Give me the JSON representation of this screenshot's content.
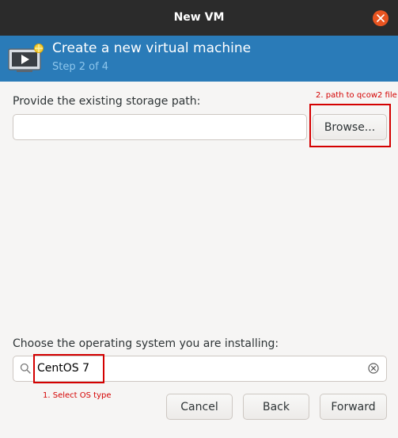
{
  "window": {
    "title": "New VM"
  },
  "header": {
    "title": "Create a new virtual machine",
    "step": "Step 2 of 4"
  },
  "storage": {
    "label": "Provide the existing storage path:",
    "value": "",
    "browse_label": "Browse..."
  },
  "os": {
    "label": "Choose the operating system you are installing:",
    "search_value": "CentOS 7"
  },
  "buttons": {
    "cancel": "Cancel",
    "back": "Back",
    "forward": "Forward"
  },
  "annotations": {
    "path_hint": "2. path to qcow2 file",
    "os_hint": "1. Select OS type"
  },
  "colors": {
    "header_bg": "#2a7bb8",
    "titlebar_bg": "#2b2b2b",
    "close_button": "#e95420",
    "annotation": "#d40000"
  }
}
